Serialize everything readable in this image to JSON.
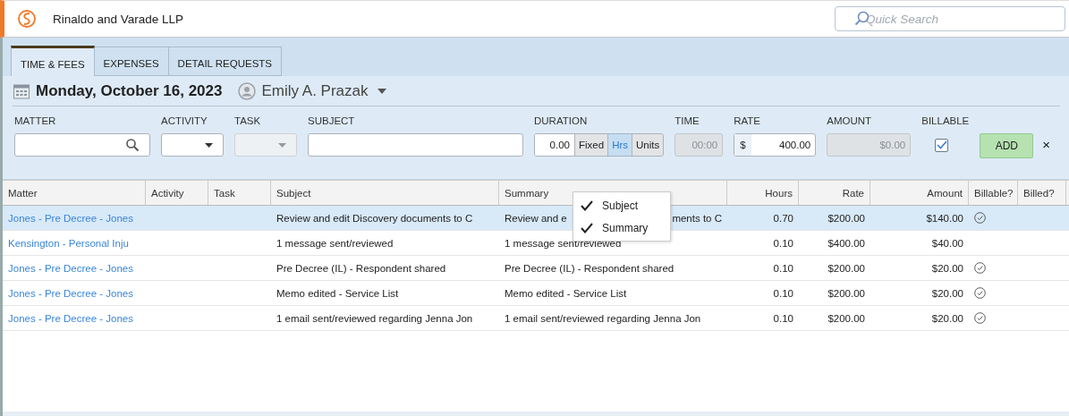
{
  "header": {
    "title": "Rinaldo and Varade LLP",
    "search": {
      "placeholder": "Quick Search"
    }
  },
  "tabs": [
    {
      "label": "TIME & FEES",
      "selected": true
    },
    {
      "label": "EXPENSES",
      "selected": false
    },
    {
      "label": "DETAIL REQUESTS",
      "selected": false
    }
  ],
  "entry": {
    "date": "Monday, October 16, 2023",
    "user": "Emily A. Prazak",
    "fields": [
      {
        "kind": "search",
        "label": "MATTER"
      },
      {
        "kind": "dropdown",
        "label": "ACTIVITY",
        "disabled": false
      },
      {
        "kind": "dropdown",
        "label": "TASK",
        "disabled": true
      },
      {
        "kind": "text",
        "label": "SUBJECT"
      },
      {
        "kind": "duration",
        "label": "DURATION",
        "value": "0.00",
        "modes": [
          {
            "label": "Fixed",
            "selected": false
          },
          {
            "label": "Hrs",
            "selected": true
          },
          {
            "label": "Units",
            "selected": false
          }
        ]
      },
      {
        "kind": "readonly",
        "label": "TIME",
        "value": "00:00"
      },
      {
        "kind": "money",
        "label": "RATE",
        "prefix": "$",
        "value": "400.00"
      },
      {
        "kind": "readonly",
        "label": "AMOUNT",
        "value": "$0.00"
      },
      {
        "kind": "checkbox",
        "label": "BILLABLE",
        "checked": true
      }
    ],
    "add_button": "ADD",
    "close": "×"
  },
  "table": {
    "columns": [
      "Matter",
      "Activity",
      "Task",
      "Subject",
      "Summary",
      "Hours",
      "Rate",
      "Amount",
      "Billable?",
      "Billed?"
    ],
    "rows": [
      {
        "matter": "Jones - Pre Decree - Jones",
        "subject": "Review and edit Discovery documents to C",
        "summary": "Review and e",
        "summary_after_menu": "ments to C",
        "hours": "0.70",
        "rate": "$200.00",
        "amount": "$140.00",
        "billable": true,
        "selected": true
      },
      {
        "matter": "Kensington - Personal Inju",
        "subject": "1 message sent/reviewed",
        "summary": "1 message sent/reviewed",
        "hours": "0.10",
        "rate": "$400.00",
        "amount": "$40.00",
        "billable": false,
        "selected": false
      },
      {
        "matter": "Jones - Pre Decree - Jones",
        "subject": "Pre Decree (IL) - Respondent shared",
        "summary": "Pre Decree (IL) - Respondent shared",
        "hours": "0.10",
        "rate": "$200.00",
        "amount": "$20.00",
        "billable": true,
        "selected": false
      },
      {
        "matter": "Jones - Pre Decree - Jones",
        "subject": "Memo edited - Service List",
        "summary": "Memo edited - Service List",
        "hours": "0.10",
        "rate": "$200.00",
        "amount": "$20.00",
        "billable": true,
        "selected": false
      },
      {
        "matter": "Jones - Pre Decree - Jones",
        "subject": "1 email sent/reviewed regarding Jenna Jon",
        "summary": "1 email sent/reviewed regarding Jenna Jon",
        "hours": "0.10",
        "rate": "$200.00",
        "amount": "$20.00",
        "billable": true,
        "selected": false
      }
    ]
  },
  "column_menu": [
    {
      "label": "Subject",
      "checked": true
    },
    {
      "label": "Summary",
      "checked": true
    }
  ]
}
